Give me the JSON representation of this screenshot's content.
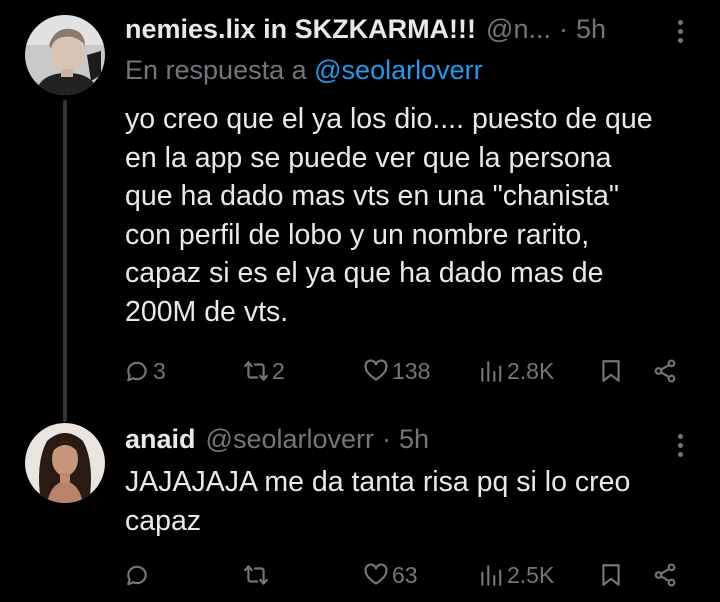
{
  "colors": {
    "background": "#000000",
    "text": "#e7e9ea",
    "muted": "#71767b",
    "link": "#1d9bf0",
    "thread_line": "#333639"
  },
  "tweets": [
    {
      "display_name": "nemies.lix in SKZKARMA!!!",
      "handle": "@n...",
      "separator": "·",
      "time": "5h",
      "reply_prefix": "En respuesta a",
      "reply_mention": "@seolarloverr",
      "text": "yo creo que el ya los dio.... puesto de que\nen la app se puede ver que la persona\nque ha dado mas vts en una \"chanista\"\ncon perfil de lobo y un nombre rarito,\ncapaz si es el ya que ha dado mas de\n200M de vts.",
      "replies": "3",
      "retweets": "2",
      "likes": "138",
      "views": "2.8K",
      "icons": [
        "reply-icon",
        "retweet-icon",
        "like-icon",
        "views-icon",
        "bookmark-icon",
        "share-icon",
        "more-icon"
      ]
    },
    {
      "display_name": "anaid",
      "handle": "@seolarloverr",
      "separator": "·",
      "time": "5h",
      "text": "JAJAJAJA me da tanta risa pq si lo creo\ncapaz",
      "replies": "",
      "retweets": "",
      "likes": "63",
      "views": "2.5K",
      "icons": [
        "reply-icon",
        "retweet-icon",
        "like-icon",
        "views-icon",
        "bookmark-icon",
        "share-icon",
        "more-icon"
      ]
    }
  ]
}
